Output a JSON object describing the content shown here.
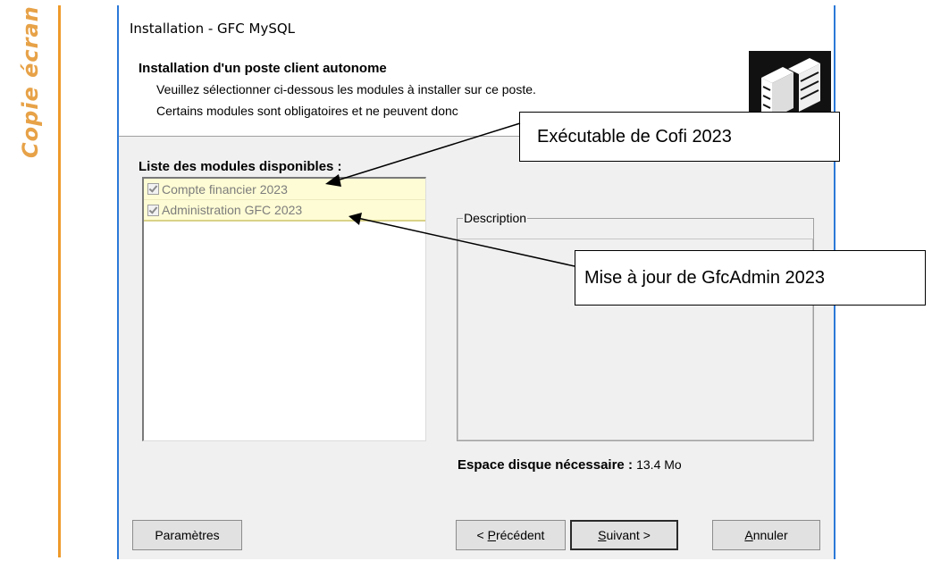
{
  "side_label": "Copie écran",
  "window": {
    "title": "Installation - GFC MySQL"
  },
  "header": {
    "title": "Installation d'un poste client autonome",
    "line1": "Veuillez sélectionner ci-dessous les modules à installer sur ce poste.",
    "line2": "Certains modules sont obligatoires et ne peuvent donc"
  },
  "modules": {
    "label": "Liste des modules disponibles :",
    "items": [
      {
        "label": "Compte financier 2023",
        "checked": true
      },
      {
        "label": "Administration GFC 2023",
        "checked": true
      }
    ]
  },
  "description": {
    "legend": "Description"
  },
  "disk": {
    "label": "Espace disque nécessaire :",
    "value": "13.4 Mo"
  },
  "buttons": {
    "params": "Paramètres",
    "prev_prefix": "< ",
    "prev_key": "P",
    "prev_rest": "récédent",
    "next_key": "S",
    "next_rest": "uivant >",
    "cancel_key": "A",
    "cancel_rest": "nnuler"
  },
  "callouts": {
    "cofi": "Exécutable de Cofi 2023",
    "admin": "Mise à jour de GfcAdmin 2023"
  },
  "colors": {
    "accent": "#ef9a2a",
    "window_border": "#2b79d8",
    "highlight": "#fefcd4"
  }
}
